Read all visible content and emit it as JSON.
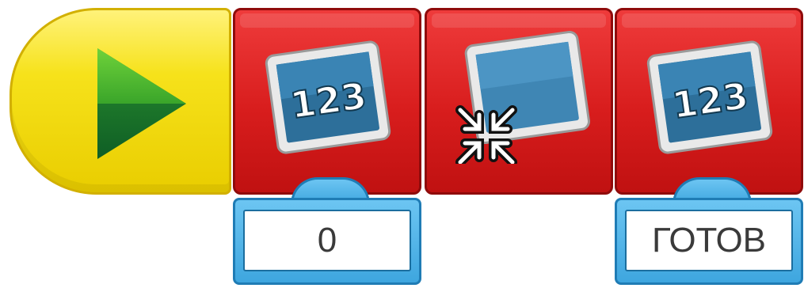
{
  "blocks": [
    {
      "type": "start",
      "icon": "play-triangle-icon",
      "color": "#f6e21b"
    },
    {
      "type": "display-number",
      "icon": "monitor-123-icon",
      "icon_text": "123",
      "color": "#d81d1d",
      "param": "0"
    },
    {
      "type": "display-clear",
      "icon": "monitor-shrink-icon",
      "color": "#d81d1d"
    },
    {
      "type": "display-number",
      "icon": "monitor-123-icon",
      "icon_text": "123",
      "color": "#d81d1d",
      "param": "ГОТОВ"
    }
  ],
  "param_field_color": "#3ea6df"
}
